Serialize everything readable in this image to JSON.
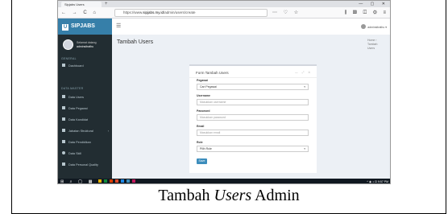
{
  "caption": {
    "prefix": "Tambah ",
    "italic": "Users",
    "suffix": " Admin"
  },
  "browser": {
    "tab_title": "Sipjabs Users",
    "tab_add": "+",
    "window_controls": "— ▢ ✕",
    "nav_buttons": "← → C ⌂",
    "url_prefix": "https://www.",
    "url_host": "sipjabs.my.id",
    "url_path": "/admin/users/create",
    "url_actions": "⋯ ♡ ☆",
    "right_tools": "⫼ ▥ ◫ ⚙ ≡"
  },
  "sidebar": {
    "brand": "SIPJABS",
    "brand_logo": "U",
    "user_role": "Selamat datang",
    "user_name": "adminsitrathu",
    "general_header": "GENERAL",
    "items_general": [
      {
        "label": "Dashboard",
        "icon": "dashboard-icon"
      }
    ],
    "master_header": "DATA MASTER",
    "items_master": [
      {
        "label": "Data Users",
        "icon": "users-icon"
      },
      {
        "label": "Data Pegawai",
        "icon": "table-icon"
      },
      {
        "label": "Data Kandidat",
        "icon": "table-icon"
      },
      {
        "label": "Jabatan Struktural",
        "icon": "table-icon",
        "caret": "‹"
      },
      {
        "label": "Data Pendidikan",
        "icon": "graduation-icon"
      },
      {
        "label": "Data Skill",
        "icon": "circle-icon"
      },
      {
        "label": "Data Personal Quality",
        "icon": "table-icon"
      }
    ]
  },
  "header": {
    "menu_icon": "☰",
    "user_label": "adminsitrathu ▾"
  },
  "page": {
    "title": "Tambah Users",
    "breadcrumb": "Home › Tambah Users"
  },
  "form": {
    "title": "Form Tambah Users",
    "tools": "— ⤢ ✕",
    "fields": [
      {
        "label": "Pegawai",
        "value": "Cari Pegawai",
        "type": "select"
      },
      {
        "label": "Username",
        "placeholder": "Masukkan username",
        "type": "text"
      },
      {
        "label": "Password",
        "placeholder": "Masukkan password",
        "type": "text"
      },
      {
        "label": "Email",
        "placeholder": "Masukkan email",
        "type": "text"
      },
      {
        "label": "Role",
        "value": "Pilih Role",
        "type": "select"
      }
    ],
    "submit": "Save"
  },
  "taskbar": {
    "start": "⊞ ⌕ ◯ ▦",
    "clock": "^ ◉ ◖ ⊡ 9:57 PM"
  },
  "colors": {
    "sidebar_bg": "#222d32",
    "brand_bg": "#367fa9",
    "primary": "#3c8dbc",
    "content_bg": "#ecf0f5"
  }
}
